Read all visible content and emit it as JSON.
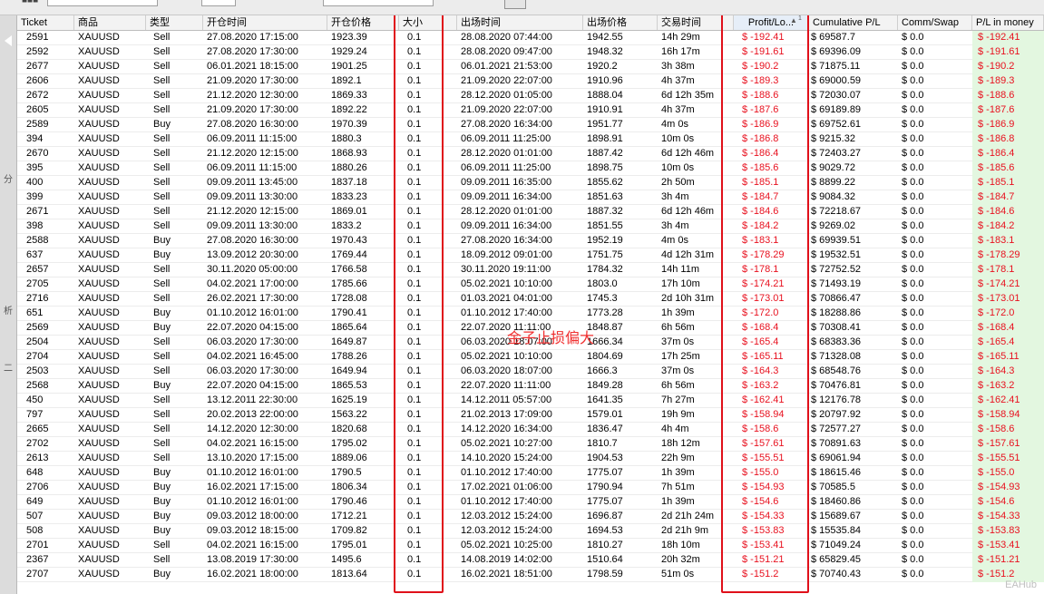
{
  "columns": [
    {
      "key": "ticket",
      "label": "Ticket"
    },
    {
      "key": "symbol",
      "label": "商品"
    },
    {
      "key": "type",
      "label": "类型"
    },
    {
      "key": "open_time",
      "label": "开仓时间"
    },
    {
      "key": "open_price",
      "label": "开仓价格"
    },
    {
      "key": "size",
      "label": "大小"
    },
    {
      "key": "close_time",
      "label": "出场时间"
    },
    {
      "key": "close_price",
      "label": "出场价格"
    },
    {
      "key": "duration",
      "label": "交易时间"
    },
    {
      "key": "profit",
      "label": "Profit/Lo...",
      "sort": "▲",
      "sort_index": "1"
    },
    {
      "key": "cum",
      "label": "Cumulative P/L"
    },
    {
      "key": "comm",
      "label": "Comm/Swap"
    },
    {
      "key": "pl",
      "label": "P/L in money"
    }
  ],
  "rows": [
    [
      "2591",
      "XAUUSD",
      "Sell",
      "27.08.2020 17:15:00",
      "1923.39",
      "0.1",
      "28.08.2020 07:44:00",
      "1942.55",
      "14h 29m",
      "$ -192.41",
      "$ 69587.7",
      "$ 0.0",
      "$ -192.41"
    ],
    [
      "2592",
      "XAUUSD",
      "Sell",
      "27.08.2020 17:30:00",
      "1929.24",
      "0.1",
      "28.08.2020 09:47:00",
      "1948.32",
      "16h 17m",
      "$ -191.61",
      "$ 69396.09",
      "$ 0.0",
      "$ -191.61"
    ],
    [
      "2677",
      "XAUUSD",
      "Sell",
      "06.01.2021 18:15:00",
      "1901.25",
      "0.1",
      "06.01.2021 21:53:00",
      "1920.2",
      "3h 38m",
      "$ -190.2",
      "$ 71875.11",
      "$ 0.0",
      "$ -190.2"
    ],
    [
      "2606",
      "XAUUSD",
      "Sell",
      "21.09.2020 17:30:00",
      "1892.1",
      "0.1",
      "21.09.2020 22:07:00",
      "1910.96",
      "4h 37m",
      "$ -189.3",
      "$ 69000.59",
      "$ 0.0",
      "$ -189.3"
    ],
    [
      "2672",
      "XAUUSD",
      "Sell",
      "21.12.2020 12:30:00",
      "1869.33",
      "0.1",
      "28.12.2020 01:05:00",
      "1888.04",
      "6d 12h 35m",
      "$ -188.6",
      "$ 72030.07",
      "$ 0.0",
      "$ -188.6"
    ],
    [
      "2605",
      "XAUUSD",
      "Sell",
      "21.09.2020 17:30:00",
      "1892.22",
      "0.1",
      "21.09.2020 22:07:00",
      "1910.91",
      "4h 37m",
      "$ -187.6",
      "$ 69189.89",
      "$ 0.0",
      "$ -187.6"
    ],
    [
      "2589",
      "XAUUSD",
      "Buy",
      "27.08.2020 16:30:00",
      "1970.39",
      "0.1",
      "27.08.2020 16:34:00",
      "1951.77",
      "4m 0s",
      "$ -186.9",
      "$ 69752.61",
      "$ 0.0",
      "$ -186.9"
    ],
    [
      "394",
      "XAUUSD",
      "Sell",
      "06.09.2011 11:15:00",
      "1880.3",
      "0.1",
      "06.09.2011 11:25:00",
      "1898.91",
      "10m 0s",
      "$ -186.8",
      "$ 9215.32",
      "$ 0.0",
      "$ -186.8"
    ],
    [
      "2670",
      "XAUUSD",
      "Sell",
      "21.12.2020 12:15:00",
      "1868.93",
      "0.1",
      "28.12.2020 01:01:00",
      "1887.42",
      "6d 12h 46m",
      "$ -186.4",
      "$ 72403.27",
      "$ 0.0",
      "$ -186.4"
    ],
    [
      "395",
      "XAUUSD",
      "Sell",
      "06.09.2011 11:15:00",
      "1880.26",
      "0.1",
      "06.09.2011 11:25:00",
      "1898.75",
      "10m 0s",
      "$ -185.6",
      "$ 9029.72",
      "$ 0.0",
      "$ -185.6"
    ],
    [
      "400",
      "XAUUSD",
      "Sell",
      "09.09.2011 13:45:00",
      "1837.18",
      "0.1",
      "09.09.2011 16:35:00",
      "1855.62",
      "2h 50m",
      "$ -185.1",
      "$ 8899.22",
      "$ 0.0",
      "$ -185.1"
    ],
    [
      "399",
      "XAUUSD",
      "Sell",
      "09.09.2011 13:30:00",
      "1833.23",
      "0.1",
      "09.09.2011 16:34:00",
      "1851.63",
      "3h 4m",
      "$ -184.7",
      "$ 9084.32",
      "$ 0.0",
      "$ -184.7"
    ],
    [
      "2671",
      "XAUUSD",
      "Sell",
      "21.12.2020 12:15:00",
      "1869.01",
      "0.1",
      "28.12.2020 01:01:00",
      "1887.32",
      "6d 12h 46m",
      "$ -184.6",
      "$ 72218.67",
      "$ 0.0",
      "$ -184.6"
    ],
    [
      "398",
      "XAUUSD",
      "Sell",
      "09.09.2011 13:30:00",
      "1833.2",
      "0.1",
      "09.09.2011 16:34:00",
      "1851.55",
      "3h 4m",
      "$ -184.2",
      "$ 9269.02",
      "$ 0.0",
      "$ -184.2"
    ],
    [
      "2588",
      "XAUUSD",
      "Buy",
      "27.08.2020 16:30:00",
      "1970.43",
      "0.1",
      "27.08.2020 16:34:00",
      "1952.19",
      "4m 0s",
      "$ -183.1",
      "$ 69939.51",
      "$ 0.0",
      "$ -183.1"
    ],
    [
      "637",
      "XAUUSD",
      "Buy",
      "13.09.2012 20:30:00",
      "1769.44",
      "0.1",
      "18.09.2012 09:01:00",
      "1751.75",
      "4d 12h 31m",
      "$ -178.29",
      "$ 19532.51",
      "$ 0.0",
      "$ -178.29"
    ],
    [
      "2657",
      "XAUUSD",
      "Sell",
      "30.11.2020 05:00:00",
      "1766.58",
      "0.1",
      "30.11.2020 19:11:00",
      "1784.32",
      "14h 11m",
      "$ -178.1",
      "$ 72752.52",
      "$ 0.0",
      "$ -178.1"
    ],
    [
      "2705",
      "XAUUSD",
      "Sell",
      "04.02.2021 17:00:00",
      "1785.66",
      "0.1",
      "05.02.2021 10:10:00",
      "1803.0",
      "17h 10m",
      "$ -174.21",
      "$ 71493.19",
      "$ 0.0",
      "$ -174.21"
    ],
    [
      "2716",
      "XAUUSD",
      "Sell",
      "26.02.2021 17:30:00",
      "1728.08",
      "0.1",
      "01.03.2021 04:01:00",
      "1745.3",
      "2d 10h 31m",
      "$ -173.01",
      "$ 70866.47",
      "$ 0.0",
      "$ -173.01"
    ],
    [
      "651",
      "XAUUSD",
      "Buy",
      "01.10.2012 16:01:00",
      "1790.41",
      "0.1",
      "01.10.2012 17:40:00",
      "1773.28",
      "1h 39m",
      "$ -172.0",
      "$ 18288.86",
      "$ 0.0",
      "$ -172.0"
    ],
    [
      "2569",
      "XAUUSD",
      "Buy",
      "22.07.2020 04:15:00",
      "1865.64",
      "0.1",
      "22.07.2020 11:11:00",
      "1848.87",
      "6h 56m",
      "$ -168.4",
      "$ 70308.41",
      "$ 0.0",
      "$ -168.4"
    ],
    [
      "2504",
      "XAUUSD",
      "Sell",
      "06.03.2020 17:30:00",
      "1649.87",
      "0.1",
      "06.03.2020 18:07:00",
      "1666.34",
      "37m 0s",
      "$ -165.4",
      "$ 68383.36",
      "$ 0.0",
      "$ -165.4"
    ],
    [
      "2704",
      "XAUUSD",
      "Sell",
      "04.02.2021 16:45:00",
      "1788.26",
      "0.1",
      "05.02.2021 10:10:00",
      "1804.69",
      "17h 25m",
      "$ -165.11",
      "$ 71328.08",
      "$ 0.0",
      "$ -165.11"
    ],
    [
      "2503",
      "XAUUSD",
      "Sell",
      "06.03.2020 17:30:00",
      "1649.94",
      "0.1",
      "06.03.2020 18:07:00",
      "1666.3",
      "37m 0s",
      "$ -164.3",
      "$ 68548.76",
      "$ 0.0",
      "$ -164.3"
    ],
    [
      "2568",
      "XAUUSD",
      "Buy",
      "22.07.2020 04:15:00",
      "1865.53",
      "0.1",
      "22.07.2020 11:11:00",
      "1849.28",
      "6h 56m",
      "$ -163.2",
      "$ 70476.81",
      "$ 0.0",
      "$ -163.2"
    ],
    [
      "450",
      "XAUUSD",
      "Sell",
      "13.12.2011 22:30:00",
      "1625.19",
      "0.1",
      "14.12.2011 05:57:00",
      "1641.35",
      "7h 27m",
      "$ -162.41",
      "$ 12176.78",
      "$ 0.0",
      "$ -162.41"
    ],
    [
      "797",
      "XAUUSD",
      "Sell",
      "20.02.2013 22:00:00",
      "1563.22",
      "0.1",
      "21.02.2013 17:09:00",
      "1579.01",
      "19h 9m",
      "$ -158.94",
      "$ 20797.92",
      "$ 0.0",
      "$ -158.94"
    ],
    [
      "2665",
      "XAUUSD",
      "Sell",
      "14.12.2020 12:30:00",
      "1820.68",
      "0.1",
      "14.12.2020 16:34:00",
      "1836.47",
      "4h 4m",
      "$ -158.6",
      "$ 72577.27",
      "$ 0.0",
      "$ -158.6"
    ],
    [
      "2702",
      "XAUUSD",
      "Sell",
      "04.02.2021 16:15:00",
      "1795.02",
      "0.1",
      "05.02.2021 10:27:00",
      "1810.7",
      "18h 12m",
      "$ -157.61",
      "$ 70891.63",
      "$ 0.0",
      "$ -157.61"
    ],
    [
      "2613",
      "XAUUSD",
      "Sell",
      "13.10.2020 17:15:00",
      "1889.06",
      "0.1",
      "14.10.2020 15:24:00",
      "1904.53",
      "22h 9m",
      "$ -155.51",
      "$ 69061.94",
      "$ 0.0",
      "$ -155.51"
    ],
    [
      "648",
      "XAUUSD",
      "Buy",
      "01.10.2012 16:01:00",
      "1790.5",
      "0.1",
      "01.10.2012 17:40:00",
      "1775.07",
      "1h 39m",
      "$ -155.0",
      "$ 18615.46",
      "$ 0.0",
      "$ -155.0"
    ],
    [
      "2706",
      "XAUUSD",
      "Buy",
      "16.02.2021 17:15:00",
      "1806.34",
      "0.1",
      "17.02.2021 01:06:00",
      "1790.94",
      "7h 51m",
      "$ -154.93",
      "$ 70585.5",
      "$ 0.0",
      "$ -154.93"
    ],
    [
      "649",
      "XAUUSD",
      "Buy",
      "01.10.2012 16:01:00",
      "1790.46",
      "0.1",
      "01.10.2012 17:40:00",
      "1775.07",
      "1h 39m",
      "$ -154.6",
      "$ 18460.86",
      "$ 0.0",
      "$ -154.6"
    ],
    [
      "507",
      "XAUUSD",
      "Buy",
      "09.03.2012 18:00:00",
      "1712.21",
      "0.1",
      "12.03.2012 15:24:00",
      "1696.87",
      "2d 21h 24m",
      "$ -154.33",
      "$ 15689.67",
      "$ 0.0",
      "$ -154.33"
    ],
    [
      "508",
      "XAUUSD",
      "Buy",
      "09.03.2012 18:15:00",
      "1709.82",
      "0.1",
      "12.03.2012 15:24:00",
      "1694.53",
      "2d 21h 9m",
      "$ -153.83",
      "$ 15535.84",
      "$ 0.0",
      "$ -153.83"
    ],
    [
      "2701",
      "XAUUSD",
      "Sell",
      "04.02.2021 16:15:00",
      "1795.01",
      "0.1",
      "05.02.2021 10:25:00",
      "1810.27",
      "18h 10m",
      "$ -153.41",
      "$ 71049.24",
      "$ 0.0",
      "$ -153.41"
    ],
    [
      "2367",
      "XAUUSD",
      "Sell",
      "13.08.2019 17:30:00",
      "1495.6",
      "0.1",
      "14.08.2019 14:02:00",
      "1510.64",
      "20h 32m",
      "$ -151.21",
      "$ 65829.45",
      "$ 0.0",
      "$ -151.21"
    ],
    [
      "2707",
      "XAUUSD",
      "Buy",
      "16.02.2021 18:00:00",
      "1813.64",
      "0.1",
      "16.02.2021 18:51:00",
      "1798.59",
      "51m 0s",
      "$ -151.2",
      "$ 70740.43",
      "$ 0.0",
      "$ -151.2"
    ]
  ],
  "annotation_text": "金子止损偏大",
  "side_chars": [
    "分",
    "析",
    "二"
  ],
  "watermark": "EAHub",
  "colors": {
    "loss": "#e8111f",
    "pl_bg": "#e3f7e0",
    "highlight": "#e0101a",
    "header_bg": "#f3f3f3"
  }
}
